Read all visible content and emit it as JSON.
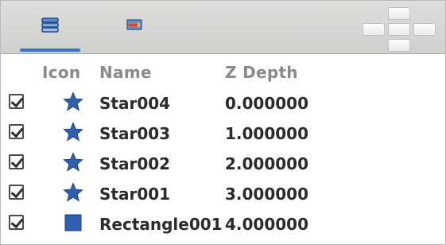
{
  "tabs": [
    {
      "icon": "layers-stack-icon",
      "active": true
    },
    {
      "icon": "object-properties-icon",
      "active": false
    }
  ],
  "columns": {
    "icon": "Icon",
    "name": "Name",
    "depth": "Z Depth"
  },
  "rows": [
    {
      "checked": true,
      "icon": "star-icon",
      "name": "Star004",
      "depth": "0.000000"
    },
    {
      "checked": true,
      "icon": "star-icon",
      "name": "Star003",
      "depth": "1.000000"
    },
    {
      "checked": true,
      "icon": "star-icon",
      "name": "Star002",
      "depth": "2.000000"
    },
    {
      "checked": true,
      "icon": "star-icon",
      "name": "Star001",
      "depth": "3.000000"
    },
    {
      "checked": true,
      "icon": "rectangle-icon",
      "name": "Rectangle001",
      "depth": "4.000000"
    }
  ],
  "colors": {
    "accent": "#3a74c6",
    "shape_fill": "#2f5fae"
  }
}
